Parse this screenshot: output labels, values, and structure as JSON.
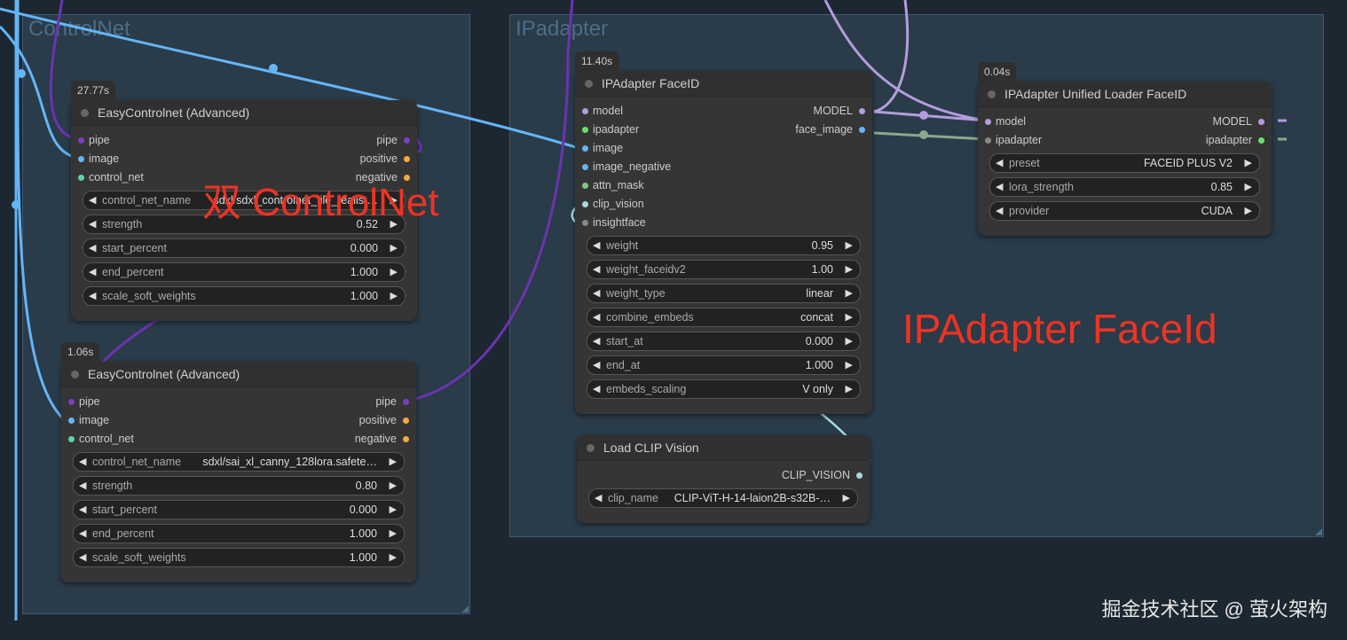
{
  "groups": [
    {
      "id": "controlnet",
      "title": "ControlNet"
    },
    {
      "id": "ipadapter",
      "title": "IPadapter"
    }
  ],
  "socket_colors": {
    "pipe": "#7b3fbf",
    "image": "#64b5f6",
    "control_net": "#5fd3a8",
    "conditioning": "#f5a742",
    "model": "#b39ddb",
    "ipadapter_in": "#888888",
    "ipadapter_out": "#68e06a",
    "mask": "#81c784",
    "clip_vision": "#a8dadc",
    "insightface": "#888888"
  },
  "nodes": [
    {
      "id": "easycontrolnet-1",
      "timing": "27.77s",
      "title": "EasyControlnet (Advanced)",
      "inputs": [
        {
          "label": "pipe",
          "color": "#7b3fbf"
        },
        {
          "label": "image",
          "color": "#64b5f6"
        },
        {
          "label": "control_net",
          "color": "#5fd3a8"
        }
      ],
      "outputs": [
        {
          "label": "pipe",
          "color": "#7b3fbf"
        },
        {
          "label": "positive",
          "color": "#f5a742"
        },
        {
          "label": "negative",
          "color": "#f5a742"
        }
      ],
      "widgets": [
        {
          "label": "control_net_name",
          "value": "sdxl/sdxl_controlnet_tile_realist…"
        },
        {
          "label": "strength",
          "value": "0.52"
        },
        {
          "label": "start_percent",
          "value": "0.000"
        },
        {
          "label": "end_percent",
          "value": "1.000"
        },
        {
          "label": "scale_soft_weights",
          "value": "1.000"
        }
      ]
    },
    {
      "id": "easycontrolnet-2",
      "timing": "1.06s",
      "title": "EasyControlnet (Advanced)",
      "inputs": [
        {
          "label": "pipe",
          "color": "#7b3fbf"
        },
        {
          "label": "image",
          "color": "#64b5f6"
        },
        {
          "label": "control_net",
          "color": "#5fd3a8"
        }
      ],
      "outputs": [
        {
          "label": "pipe",
          "color": "#7b3fbf"
        },
        {
          "label": "positive",
          "color": "#f5a742"
        },
        {
          "label": "negative",
          "color": "#f5a742"
        }
      ],
      "widgets": [
        {
          "label": "control_net_name",
          "value": "sdxl/sai_xl_canny_128lora.safete…"
        },
        {
          "label": "strength",
          "value": "0.80"
        },
        {
          "label": "start_percent",
          "value": "0.000"
        },
        {
          "label": "end_percent",
          "value": "1.000"
        },
        {
          "label": "scale_soft_weights",
          "value": "1.000"
        }
      ]
    },
    {
      "id": "ipadapter-faceid",
      "timing": "11.40s",
      "title": "IPAdapter FaceID",
      "inputs": [
        {
          "label": "model",
          "color": "#b39ddb"
        },
        {
          "label": "ipadapter",
          "color": "#68e06a"
        },
        {
          "label": "image",
          "color": "#64b5f6"
        },
        {
          "label": "image_negative",
          "color": "#64b5f6"
        },
        {
          "label": "attn_mask",
          "color": "#81c784"
        },
        {
          "label": "clip_vision",
          "color": "#a8dadc"
        },
        {
          "label": "insightface",
          "color": "#888888"
        }
      ],
      "outputs": [
        {
          "label": "MODEL",
          "color": "#b39ddb"
        },
        {
          "label": "face_image",
          "color": "#64b5f6"
        }
      ],
      "widgets": [
        {
          "label": "weight",
          "value": "0.95"
        },
        {
          "label": "weight_faceidv2",
          "value": "1.00"
        },
        {
          "label": "weight_type",
          "value": "linear"
        },
        {
          "label": "combine_embeds",
          "value": "concat"
        },
        {
          "label": "start_at",
          "value": "0.000"
        },
        {
          "label": "end_at",
          "value": "1.000"
        },
        {
          "label": "embeds_scaling",
          "value": "V only"
        }
      ]
    },
    {
      "id": "ipadapter-unified-loader-faceid",
      "timing": "0.04s",
      "title": "IPAdapter Unified Loader FaceID",
      "inputs": [
        {
          "label": "model",
          "color": "#b39ddb"
        },
        {
          "label": "ipadapter",
          "color": "#888888"
        }
      ],
      "outputs": [
        {
          "label": "MODEL",
          "color": "#b39ddb"
        },
        {
          "label": "ipadapter",
          "color": "#68e06a"
        }
      ],
      "widgets": [
        {
          "label": "preset",
          "value": "FACEID PLUS V2"
        },
        {
          "label": "lora_strength",
          "value": "0.85"
        },
        {
          "label": "provider",
          "value": "CUDA"
        }
      ]
    },
    {
      "id": "load-clip-vision",
      "timing": null,
      "title": "Load CLIP Vision",
      "inputs": [],
      "outputs": [
        {
          "label": "CLIP_VISION",
          "color": "#a8dadc"
        }
      ],
      "widgets": [
        {
          "label": "clip_name",
          "value": "CLIP-ViT-H-14-laion2B-s32B-…"
        }
      ]
    }
  ],
  "annotations": {
    "controlnet": "双 ControlNet",
    "ipadapter": "IPAdapter FaceId"
  },
  "watermark": "掘金技术社区 @ 萤火架构",
  "arrows": {
    "left": "◀",
    "right": "▶"
  }
}
